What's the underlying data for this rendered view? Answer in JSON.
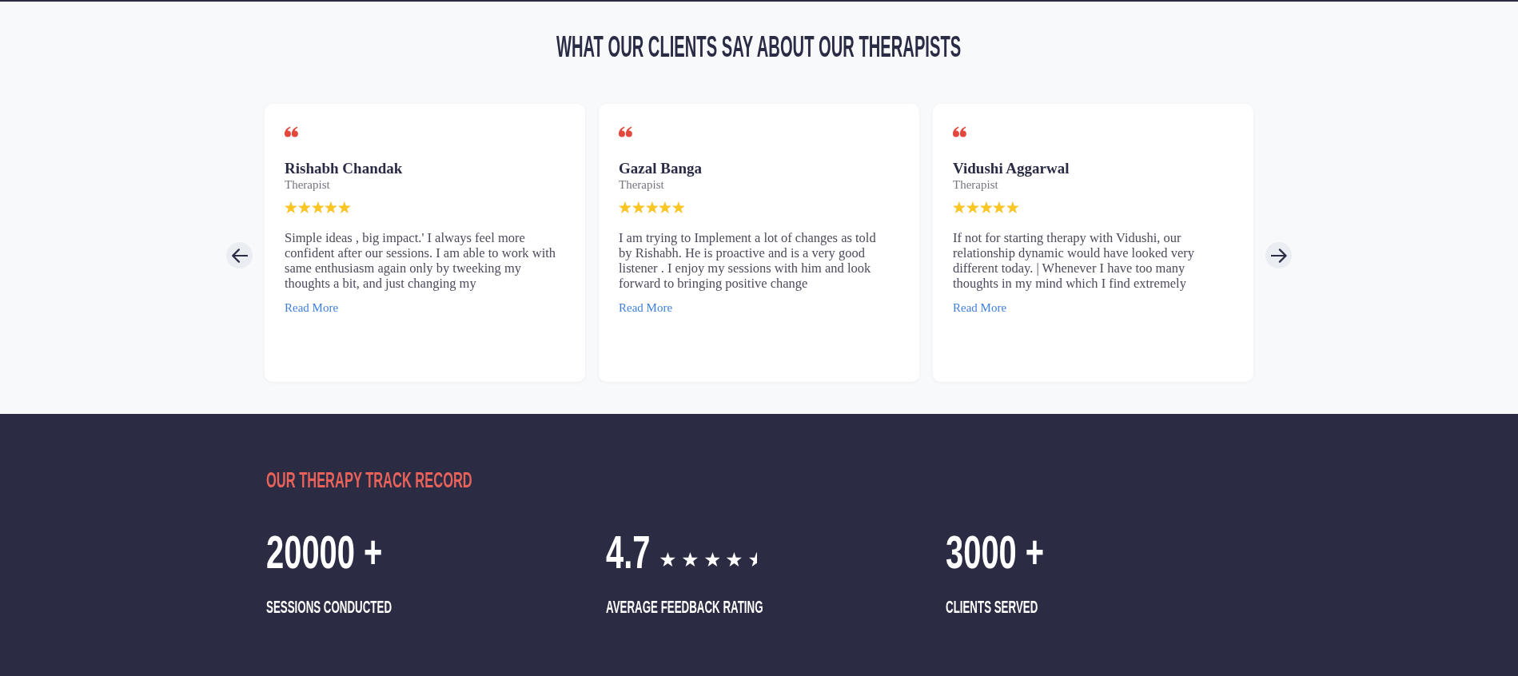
{
  "testimonials_section": {
    "title": "WHAT OUR CLIENTS SAY ABOUT OUR THERAPISTS",
    "cards": [
      {
        "name": "Rishabh Chandak",
        "role": "Therapist",
        "stars": 5,
        "quote": "Simple ideas , big impact.' I always feel more confident after our sessions. I am able to work with same enthusiasm again only by tweeking my thoughts a bit, and just changing my",
        "link": "Read More"
      },
      {
        "name": "Gazal Banga",
        "role": "Therapist",
        "stars": 5,
        "quote": "I am trying to Implement a lot of changes as told by Rishabh. He is proactive and is a very good listener . I enjoy my sessions with him and look forward to bringing positive change",
        "link": "Read More"
      },
      {
        "name": "Vidushi Aggarwal",
        "role": "Therapist",
        "stars": 5,
        "quote": "If not for starting therapy with Vidushi, our relationship dynamic would have looked very different today. | Whenever I have too many thoughts in my mind which I find extremely",
        "link": "Read More"
      }
    ]
  },
  "track_record": {
    "heading": "OUR THERAPY TRACK RECORD",
    "stats": [
      {
        "value": "20000 +",
        "label": "SESSIONS CONDUCTED"
      },
      {
        "value": "4.7",
        "stars": 4.5,
        "label": "AVERAGE FEEDBACK RATING"
      },
      {
        "value": "3000 +",
        "label": "CLIENTS SERVED"
      }
    ]
  }
}
